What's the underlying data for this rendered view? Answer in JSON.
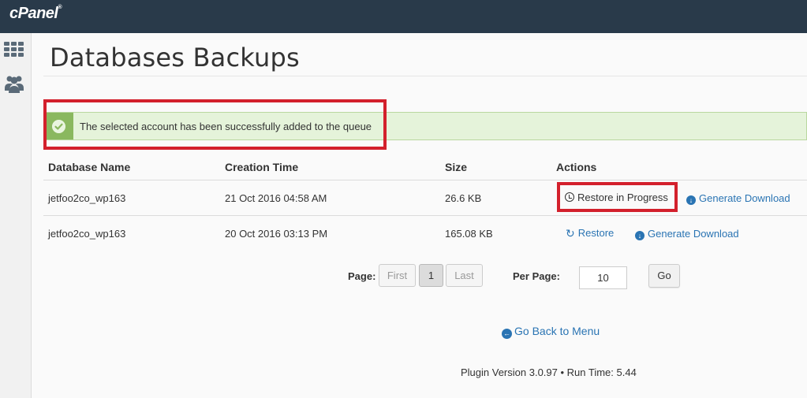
{
  "app": {
    "logo": "cPanel",
    "logo_mark": "®"
  },
  "sidebar": {
    "items": [
      {
        "icon": "grid-icon"
      },
      {
        "icon": "users-icon"
      }
    ]
  },
  "page": {
    "title": "Databases Backups"
  },
  "alert": {
    "message": "The selected account has been successfully added to the queue",
    "icon": "check-circle-icon",
    "color": "#8ab85f"
  },
  "table": {
    "columns": [
      "Database Name",
      "Creation Time",
      "Size",
      "Actions"
    ],
    "rows": [
      {
        "name": "jetfoo2co_wp163",
        "created": "21 Oct 2016 04:58 AM",
        "size": "26.6 KB",
        "action_primary": "Restore in Progress",
        "action_primary_icon": "clock-icon",
        "action_secondary": "Generate Download"
      },
      {
        "name": "jetfoo2co_wp163",
        "created": "20 Oct 2016 03:13 PM",
        "size": "165.08 KB",
        "action_primary": "Restore",
        "action_primary_icon": "refresh-icon",
        "action_secondary": "Generate Download"
      }
    ]
  },
  "pagination": {
    "page_label": "Page:",
    "first": "First",
    "current": "1",
    "last": "Last",
    "per_page_label": "Per Page:",
    "per_page_value": "10",
    "go": "Go"
  },
  "nav": {
    "back": "Go Back to Menu"
  },
  "footer": {
    "text": "Plugin Version 3.0.97 • Run Time: 5.44"
  },
  "colors": {
    "topbar": "#293a4a",
    "link": "#2a74b3",
    "highlight": "#d3202c",
    "alert_bg": "#e5f3da"
  }
}
